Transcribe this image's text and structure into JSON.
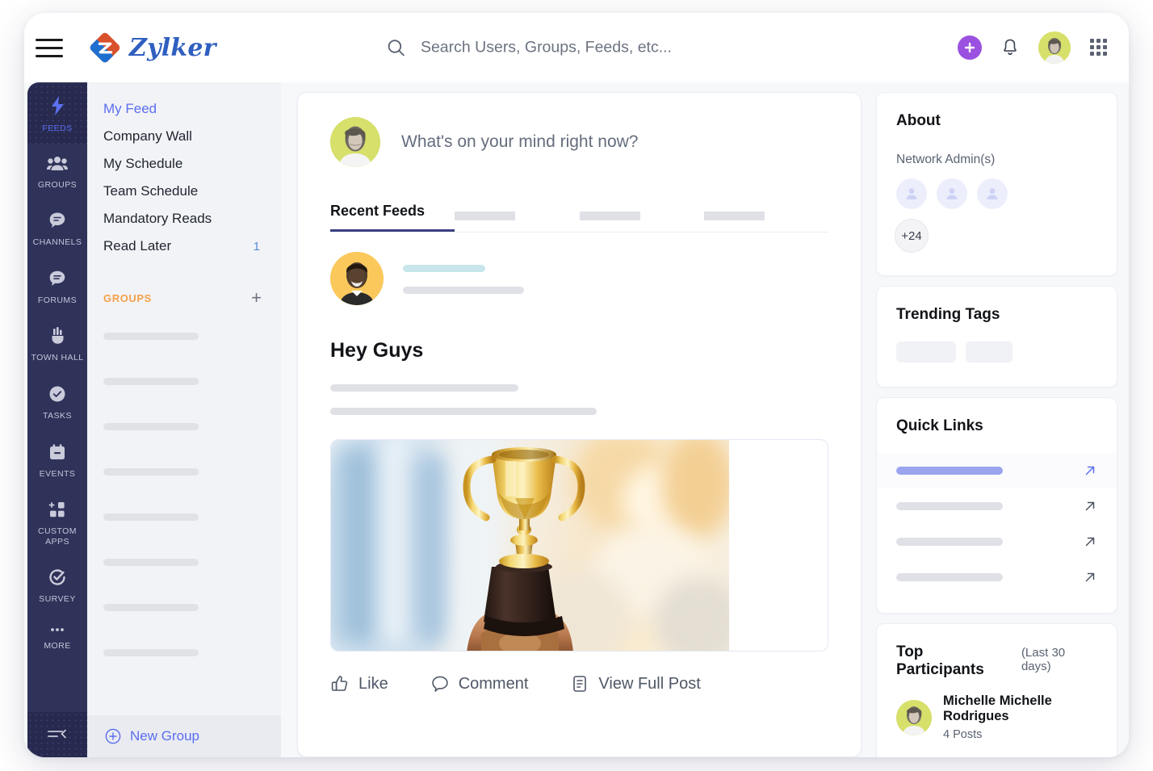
{
  "header": {
    "menu_icon": "hamburger-icon",
    "brand_name": "Zylker",
    "search_placeholder": "Search Users, Groups, Feeds, etc...",
    "search_value": "",
    "search_icon": "search-icon",
    "add_icon": "plus-icon",
    "notifications_icon": "bell-icon",
    "apps_icon": "grid-apps-icon",
    "avatar": "user-avatar"
  },
  "rail": {
    "items": [
      {
        "label": "FEEDS",
        "icon": "lightning-bolt-icon",
        "active": true
      },
      {
        "label": "GROUPS",
        "icon": "people-group-icon",
        "active": false
      },
      {
        "label": "CHANNELS",
        "icon": "chat-bubble-lines-icon",
        "active": false
      },
      {
        "label": "FORUMS",
        "icon": "chat-bubble-icon",
        "active": false
      },
      {
        "label": "TOWN HALL",
        "icon": "megaphone-icon",
        "active": false
      },
      {
        "label": "TASKS",
        "icon": "check-circle-icon",
        "active": false
      },
      {
        "label": "EVENTS",
        "icon": "calendar-icon",
        "active": false
      },
      {
        "label": "CUSTOM APPS",
        "icon": "add-squares-icon",
        "active": false
      },
      {
        "label": "SURVEY",
        "icon": "survey-check-icon",
        "active": false
      },
      {
        "label": "MORE",
        "icon": "ellipsis-icon",
        "active": false
      }
    ],
    "collapse_icon": "collapse-sidebar-icon"
  },
  "sidebar": {
    "items": [
      {
        "label": "My Feed",
        "badge": "",
        "active": true
      },
      {
        "label": "Company Wall",
        "badge": "",
        "active": false
      },
      {
        "label": "My Schedule",
        "badge": "",
        "active": false
      },
      {
        "label": "Team Schedule",
        "badge": "",
        "active": false
      },
      {
        "label": "Mandatory Reads",
        "badge": "",
        "active": false
      },
      {
        "label": "Read Later",
        "badge": "1",
        "active": false
      }
    ],
    "groups_section": {
      "title": "GROUPS",
      "add_icon": "plus-icon"
    },
    "group_placeholder_count": 8,
    "footer": {
      "label": "New Group",
      "icon": "plus-circle-icon"
    }
  },
  "composer": {
    "prompt": "What's on your mind right now?",
    "avatar": "user-avatar"
  },
  "tabs": [
    {
      "label": "Recent Feeds",
      "active": true
    },
    {
      "label": "",
      "active": false
    },
    {
      "label": "",
      "active": false
    },
    {
      "label": "",
      "active": false
    }
  ],
  "post": {
    "author_avatar": "author-avatar",
    "title": "Hey Guys",
    "image_alt": "gold-trophy-photo",
    "actions": [
      {
        "label": "Like",
        "icon": "thumbs-up-icon"
      },
      {
        "label": "Comment",
        "icon": "comment-bubble-icon"
      },
      {
        "label": "View Full Post",
        "icon": "document-icon"
      }
    ]
  },
  "about": {
    "title": "About",
    "admins_label": "Network Admin(s)",
    "admin_count_more": "+24",
    "admin_avatars": 3
  },
  "trending": {
    "title": "Trending Tags",
    "tag_placeholders": 2
  },
  "quick_links": {
    "title": "Quick Links",
    "rows": [
      {
        "active": true,
        "arrow_icon": "arrow-up-right-icon"
      },
      {
        "active": false,
        "arrow_icon": "arrow-up-right-icon"
      },
      {
        "active": false,
        "arrow_icon": "arrow-up-right-icon"
      },
      {
        "active": false,
        "arrow_icon": "arrow-up-right-icon"
      }
    ]
  },
  "top_participants": {
    "title": "Top Participants",
    "note": "(Last 30 days)",
    "people": [
      {
        "name": "Michelle Michelle Rodrigues",
        "posts": "4 Posts"
      }
    ]
  },
  "colors": {
    "accent_blue": "#5b6ef0",
    "rail_bg": "#2f3259",
    "orange": "#f5a04a",
    "purple": "#9b51e0",
    "brand_blue": "#2f5fc0",
    "brand_red": "#d9512c"
  }
}
